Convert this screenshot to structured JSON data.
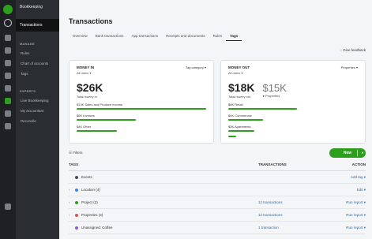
{
  "sidebar": {
    "app_title": "Bookkeeping",
    "active_item": "Transactions",
    "sections": [
      {
        "title": "MANAGE",
        "items": [
          "Rules",
          "Chart of accounts",
          "Tags"
        ]
      },
      {
        "title": "EXPERTS",
        "items": [
          "Live Bookkeeping",
          "My accountant",
          "Reconcile"
        ]
      }
    ]
  },
  "page": {
    "title": "Transactions",
    "tabs": [
      "Overview",
      "Bank transactions",
      "App transactions",
      "Receipts and documents",
      "Rules",
      "Tags"
    ],
    "selected_tab": "Tags",
    "feedback": "Give feedback"
  },
  "money_in": {
    "label": "MONEY IN",
    "period": "All dates ▾",
    "dropdown": "Tag category ▾",
    "amount": "$26K",
    "amount_sub": "Total money in",
    "rows": [
      {
        "text": "$13K Sales and Produce income",
        "fill": 1.0
      },
      {
        "text": "$6K Invoices",
        "fill": 0.46
      },
      {
        "text": "$4K Other",
        "fill": 0.31
      }
    ]
  },
  "money_out": {
    "label": "MONEY OUT",
    "period": "All dates ▾",
    "dropdown": "Properties ▾",
    "amount": "$18K",
    "amount_sub": "Total money out",
    "alt_amount": "$15K",
    "alt_sub": "● Properties",
    "rows": [
      {
        "text": "$8K Retail",
        "fill": 0.53
      },
      {
        "text": "$4K Commercial",
        "fill": 0.27
      },
      {
        "text": "$3K Apartments",
        "fill": 0.2
      },
      {
        "text": "",
        "fill": 0.06
      }
    ]
  },
  "toolbar": {
    "filters": "Filters",
    "new_label": "New"
  },
  "table": {
    "headers": {
      "tags": "TAGS",
      "transactions": "TRANSACTIONS",
      "action": "ACTION"
    },
    "rows": [
      {
        "chevron": "",
        "color": "#4a4f55",
        "name": "Events",
        "tx": "",
        "action": "Add tag ▾"
      },
      {
        "chevron": "›",
        "color": "#3b82f6",
        "name": "Location (4)",
        "tx": "",
        "action": "Edit ▾"
      },
      {
        "chevron": "›",
        "color": "#2ca01c",
        "name": "Project (2)",
        "tx": "12 transactions",
        "action": "Run report ▾"
      },
      {
        "chevron": "›",
        "color": "#e05252",
        "name": "Properties (3)",
        "tx": "12 transactions",
        "action": "Run report ▾"
      },
      {
        "chevron": "",
        "color": "#8a5cd6",
        "name": "Unassigned: Coffee",
        "tx": "1 transaction",
        "action": "Run report ▾"
      }
    ]
  },
  "colors": {
    "accent": "#2ca01c",
    "link": "#2b6cb0",
    "sidebar": "#2a2d31"
  }
}
